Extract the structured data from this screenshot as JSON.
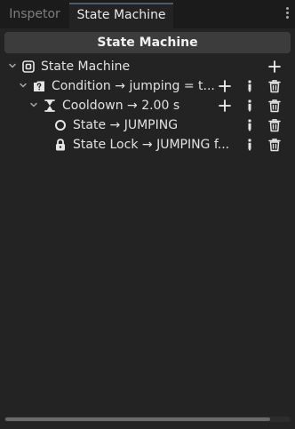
{
  "tabs": [
    {
      "label": "Inspetor",
      "active": false
    },
    {
      "label": "State Machine",
      "active": true
    }
  ],
  "header": {
    "title": "State Machine"
  },
  "tree": [
    {
      "label": "State Machine",
      "icon": "state-machine-icon",
      "depth": 0,
      "expanded": true
    },
    {
      "label": "Condition → jumping = t...",
      "icon": "condition-icon",
      "depth": 1,
      "expanded": true
    },
    {
      "label": "Cooldown → 2.00 s",
      "icon": "hourglass-icon",
      "depth": 2,
      "expanded": true
    },
    {
      "label": "State → JUMPING",
      "icon": "state-circle-icon",
      "depth": 3
    },
    {
      "label": "State Lock → JUMPING f...",
      "icon": "lock-icon",
      "depth": 3
    }
  ],
  "colors": {
    "background": "#232323",
    "tabbar": "#1b1b1b",
    "header": "#3c3c3c",
    "text": "#e4e4e4"
  }
}
